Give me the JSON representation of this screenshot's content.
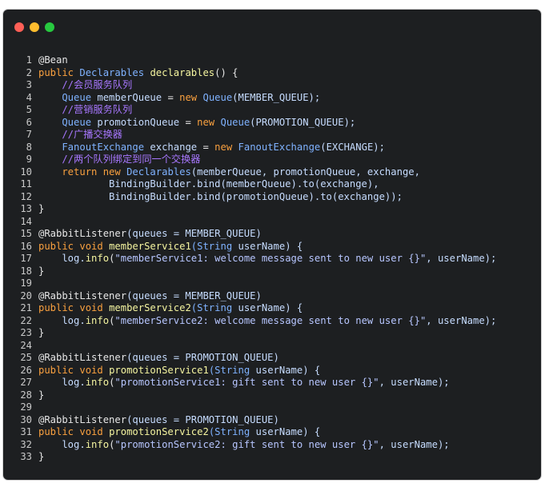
{
  "window": {
    "controls": [
      "close",
      "minimize",
      "maximize"
    ]
  },
  "code": {
    "lines": [
      {
        "n": "1",
        "tokens": [
          {
            "t": "@Bean",
            "c": "an"
          }
        ]
      },
      {
        "n": "2",
        "tokens": [
          {
            "t": "public ",
            "c": "kw"
          },
          {
            "t": "Declarables ",
            "c": "ty"
          },
          {
            "t": "declarables",
            "c": "fn"
          },
          {
            "t": "() {",
            "c": "pl"
          }
        ]
      },
      {
        "n": "3",
        "tokens": [
          {
            "t": "    //会员服务队列",
            "c": "cm"
          }
        ]
      },
      {
        "n": "4",
        "tokens": [
          {
            "t": "    Queue ",
            "c": "ty"
          },
          {
            "t": "memberQueue ",
            "c": "id"
          },
          {
            "t": "= ",
            "c": "pl"
          },
          {
            "t": "new ",
            "c": "kw"
          },
          {
            "t": "Queue",
            "c": "ty"
          },
          {
            "t": "(MEMBER_QUEUE);",
            "c": "ct"
          }
        ]
      },
      {
        "n": "5",
        "tokens": [
          {
            "t": "    //营销服务队列",
            "c": "cm"
          }
        ]
      },
      {
        "n": "6",
        "tokens": [
          {
            "t": "    Queue ",
            "c": "ty"
          },
          {
            "t": "promotionQueue ",
            "c": "id"
          },
          {
            "t": "= ",
            "c": "pl"
          },
          {
            "t": "new ",
            "c": "kw"
          },
          {
            "t": "Queue",
            "c": "ty"
          },
          {
            "t": "(PROMOTION_QUEUE);",
            "c": "ct"
          }
        ]
      },
      {
        "n": "7",
        "tokens": [
          {
            "t": "    //广播交换器",
            "c": "cm"
          }
        ]
      },
      {
        "n": "8",
        "tokens": [
          {
            "t": "    FanoutExchange ",
            "c": "ty"
          },
          {
            "t": "exchange ",
            "c": "id"
          },
          {
            "t": "= ",
            "c": "pl"
          },
          {
            "t": "new ",
            "c": "kw"
          },
          {
            "t": "FanoutExchange",
            "c": "ty"
          },
          {
            "t": "(EXCHANGE);",
            "c": "ct"
          }
        ]
      },
      {
        "n": "9",
        "tokens": [
          {
            "t": "    //两个队列绑定到同一个交换器",
            "c": "cm"
          }
        ]
      },
      {
        "n": "10",
        "tokens": [
          {
            "t": "    return ",
            "c": "kw"
          },
          {
            "t": "new ",
            "c": "kw"
          },
          {
            "t": "Declarables",
            "c": "ty"
          },
          {
            "t": "(memberQueue, promotionQueue, exchange,",
            "c": "id"
          }
        ]
      },
      {
        "n": "11",
        "tokens": [
          {
            "t": "            BindingBuilder.bind(memberQueue).to(exchange),",
            "c": "id"
          }
        ]
      },
      {
        "n": "12",
        "tokens": [
          {
            "t": "            BindingBuilder.bind(promotionQueue).to(exchange));",
            "c": "id"
          }
        ]
      },
      {
        "n": "13",
        "tokens": [
          {
            "t": "}",
            "c": "pl"
          }
        ]
      },
      {
        "n": "14",
        "tokens": []
      },
      {
        "n": "15",
        "tokens": [
          {
            "t": "@RabbitListener",
            "c": "an"
          },
          {
            "t": "(queues = MEMBER_QUEUE)",
            "c": "ct"
          }
        ]
      },
      {
        "n": "16",
        "tokens": [
          {
            "t": "public ",
            "c": "kw"
          },
          {
            "t": "void ",
            "c": "kw"
          },
          {
            "t": "memberService1",
            "c": "fn"
          },
          {
            "t": "(String ",
            "c": "ty"
          },
          {
            "t": "userName) {",
            "c": "id"
          }
        ]
      },
      {
        "n": "17",
        "tokens": [
          {
            "t": "    log.",
            "c": "id"
          },
          {
            "t": "info",
            "c": "fn"
          },
          {
            "t": "(",
            "c": "pl"
          },
          {
            "t": "\"memberService1: welcome message sent to new user {}\"",
            "c": "str"
          },
          {
            "t": ", userName);",
            "c": "id"
          }
        ]
      },
      {
        "n": "18",
        "tokens": [
          {
            "t": "}",
            "c": "pl"
          }
        ]
      },
      {
        "n": "19",
        "tokens": []
      },
      {
        "n": "20",
        "tokens": [
          {
            "t": "@RabbitListener",
            "c": "an"
          },
          {
            "t": "(queues = MEMBER_QUEUE)",
            "c": "ct"
          }
        ]
      },
      {
        "n": "21",
        "tokens": [
          {
            "t": "public ",
            "c": "kw"
          },
          {
            "t": "void ",
            "c": "kw"
          },
          {
            "t": "memberService2",
            "c": "fn"
          },
          {
            "t": "(String ",
            "c": "ty"
          },
          {
            "t": "userName) {",
            "c": "id"
          }
        ]
      },
      {
        "n": "22",
        "tokens": [
          {
            "t": "    log.",
            "c": "id"
          },
          {
            "t": "info",
            "c": "fn"
          },
          {
            "t": "(",
            "c": "pl"
          },
          {
            "t": "\"memberService2: welcome message sent to new user {}\"",
            "c": "str"
          },
          {
            "t": ", userName);",
            "c": "id"
          }
        ]
      },
      {
        "n": "23",
        "tokens": [
          {
            "t": "}",
            "c": "pl"
          }
        ]
      },
      {
        "n": "24",
        "tokens": []
      },
      {
        "n": "25",
        "tokens": [
          {
            "t": "@RabbitListener",
            "c": "an"
          },
          {
            "t": "(queues = PROMOTION_QUEUE)",
            "c": "ct"
          }
        ]
      },
      {
        "n": "26",
        "tokens": [
          {
            "t": "public ",
            "c": "kw"
          },
          {
            "t": "void ",
            "c": "kw"
          },
          {
            "t": "promotionService1",
            "c": "fn"
          },
          {
            "t": "(String ",
            "c": "ty"
          },
          {
            "t": "userName) {",
            "c": "id"
          }
        ]
      },
      {
        "n": "27",
        "tokens": [
          {
            "t": "    log.",
            "c": "id"
          },
          {
            "t": "info",
            "c": "fn"
          },
          {
            "t": "(",
            "c": "pl"
          },
          {
            "t": "\"promotionService1: gift sent to new user {}\"",
            "c": "str"
          },
          {
            "t": ", userName);",
            "c": "id"
          }
        ]
      },
      {
        "n": "28",
        "tokens": [
          {
            "t": "}",
            "c": "pl"
          }
        ]
      },
      {
        "n": "29",
        "tokens": []
      },
      {
        "n": "30",
        "tokens": [
          {
            "t": "@RabbitListener",
            "c": "an"
          },
          {
            "t": "(queues = PROMOTION_QUEUE)",
            "c": "ct"
          }
        ]
      },
      {
        "n": "31",
        "tokens": [
          {
            "t": "public ",
            "c": "kw"
          },
          {
            "t": "void ",
            "c": "kw"
          },
          {
            "t": "promotionService2",
            "c": "fn"
          },
          {
            "t": "(String ",
            "c": "ty"
          },
          {
            "t": "userName) {",
            "c": "id"
          }
        ]
      },
      {
        "n": "32",
        "tokens": [
          {
            "t": "    log.",
            "c": "id"
          },
          {
            "t": "info",
            "c": "fn"
          },
          {
            "t": "(",
            "c": "pl"
          },
          {
            "t": "\"promotionService2: gift sent to new user {}\"",
            "c": "str"
          },
          {
            "t": ", userName);",
            "c": "id"
          }
        ]
      },
      {
        "n": "33",
        "tokens": [
          {
            "t": "}",
            "c": "pl"
          }
        ]
      }
    ]
  }
}
